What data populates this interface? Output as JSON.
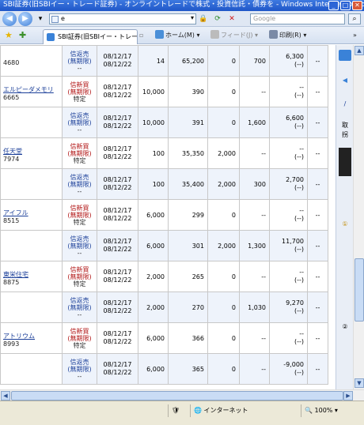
{
  "window": {
    "title": "SBI証券(旧SBIイー・トレード証券) - オンライントレードで株式・投資信託・債券を - Windows Internet Explorer"
  },
  "addressbar": {
    "url": "e",
    "search_placeholder": "Google"
  },
  "tabbar": {
    "tab_label": "SBI証券(旧SBIイー・トレー...",
    "home_label": "ホーム(M)",
    "feed_label": "フィード(J)",
    "print_label": "印刷(R)"
  },
  "rows": [
    {
      "name": "",
      "code": "4680",
      "type": [
        "信返売",
        "(無期限)",
        "--"
      ],
      "side": "sell",
      "dates": [
        "08/12/17",
        "08/12/22"
      ],
      "qty": "14",
      "price": "65,200",
      "a": "0",
      "b": "700",
      "pl": [
        "6,300",
        "(--)"
      ],
      "dash": "--"
    },
    {
      "name": "エルピーダメモリ",
      "code": "6665",
      "type": [
        "信新買",
        "(無期限)",
        "特定"
      ],
      "side": "buy",
      "dates": [
        "08/12/17",
        "08/12/22"
      ],
      "qty": "10,000",
      "price": "390",
      "a": "0",
      "b": "--",
      "pl": [
        "--",
        "(--)"
      ],
      "dash": "--"
    },
    {
      "name": "",
      "code": "",
      "type": [
        "信返売",
        "(無期限)",
        "--"
      ],
      "side": "sell",
      "dates": [
        "08/12/17",
        "08/12/22"
      ],
      "qty": "10,000",
      "price": "391",
      "a": "0",
      "b": "1,600",
      "pl": [
        "6,600",
        "(--)"
      ],
      "dash": "--"
    },
    {
      "name": "任天堂",
      "code": "7974",
      "type": [
        "信新買",
        "(無期限)",
        "特定"
      ],
      "side": "buy",
      "dates": [
        "08/12/17",
        "08/12/22"
      ],
      "qty": "100",
      "price": "35,350",
      "a": "2,000",
      "b": "--",
      "pl": [
        "--",
        "(--)"
      ],
      "dash": "--"
    },
    {
      "name": "",
      "code": "",
      "type": [
        "信返売",
        "(無期限)",
        "--"
      ],
      "side": "sell",
      "dates": [
        "08/12/17",
        "08/12/22"
      ],
      "qty": "100",
      "price": "35,400",
      "a": "2,000",
      "b": "300",
      "pl": [
        "2,700",
        "(--)"
      ],
      "dash": "--"
    },
    {
      "name": "アイフル",
      "code": "8515",
      "type": [
        "信新買",
        "(無期限)",
        "特定"
      ],
      "side": "buy",
      "dates": [
        "08/12/17",
        "08/12/22"
      ],
      "qty": "6,000",
      "price": "299",
      "a": "0",
      "b": "--",
      "pl": [
        "--",
        "(--)"
      ],
      "dash": "--"
    },
    {
      "name": "",
      "code": "",
      "type": [
        "信返売",
        "(無期限)",
        "--"
      ],
      "side": "sell",
      "dates": [
        "08/12/17",
        "08/12/22"
      ],
      "qty": "6,000",
      "price": "301",
      "a": "2,000",
      "b": "1,300",
      "pl": [
        "11,700",
        "(--)"
      ],
      "dash": "--"
    },
    {
      "name": "東栄住宅",
      "code": "8875",
      "type": [
        "信新買",
        "(無期限)",
        "特定"
      ],
      "side": "buy",
      "dates": [
        "08/12/17",
        "08/12/22"
      ],
      "qty": "2,000",
      "price": "265",
      "a": "0",
      "b": "--",
      "pl": [
        "--",
        "(--)"
      ],
      "dash": "--"
    },
    {
      "name": "",
      "code": "",
      "type": [
        "信返売",
        "(無期限)",
        "--"
      ],
      "side": "sell",
      "dates": [
        "08/12/17",
        "08/12/22"
      ],
      "qty": "2,000",
      "price": "270",
      "a": "0",
      "b": "1,030",
      "pl": [
        "9,270",
        "(--)"
      ],
      "dash": "--"
    },
    {
      "name": "アトリウム",
      "code": "8993",
      "type": [
        "信新買",
        "(無期限)",
        "特定"
      ],
      "side": "buy",
      "dates": [
        "08/12/17",
        "08/12/22"
      ],
      "qty": "6,000",
      "price": "366",
      "a": "0",
      "b": "--",
      "pl": [
        "--",
        "(--)"
      ],
      "dash": "--"
    },
    {
      "name": "",
      "code": "",
      "type": [
        "信返売",
        "(無期限)",
        "--"
      ],
      "side": "sell",
      "dates": [
        "08/12/17",
        "08/12/22"
      ],
      "qty": "6,000",
      "price": "365",
      "a": "0",
      "b": "--",
      "pl": [
        "-9,000",
        "(--)"
      ],
      "dash": "--"
    }
  ],
  "sidepanel": [
    "取",
    "拐"
  ],
  "statusbar": {
    "zone": "インターネット",
    "zoom": "100%"
  }
}
